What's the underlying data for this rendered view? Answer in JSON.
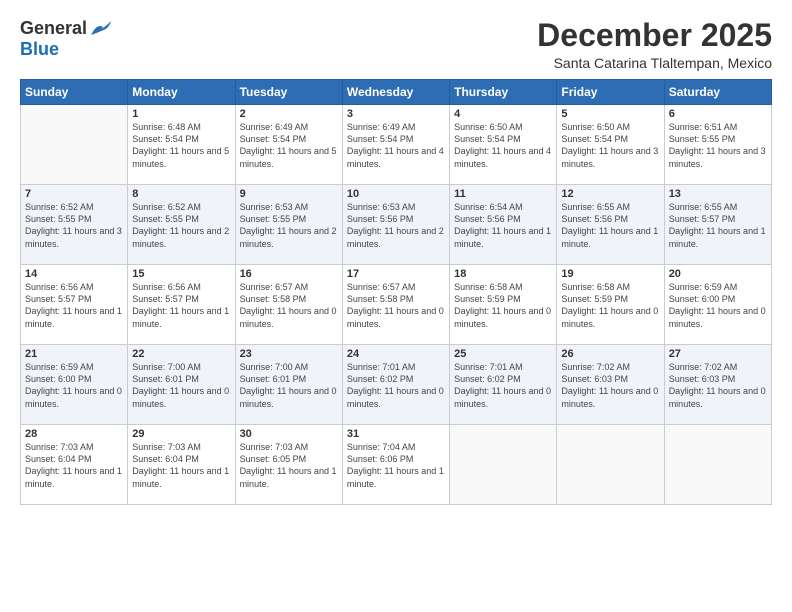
{
  "logo": {
    "general": "General",
    "blue": "Blue"
  },
  "title": "December 2025",
  "subtitle": "Santa Catarina Tlaltempan, Mexico",
  "headers": [
    "Sunday",
    "Monday",
    "Tuesday",
    "Wednesday",
    "Thursday",
    "Friday",
    "Saturday"
  ],
  "weeks": [
    [
      {
        "day": "",
        "sunrise": "",
        "sunset": "",
        "daylight": ""
      },
      {
        "day": "1",
        "sunrise": "Sunrise: 6:48 AM",
        "sunset": "Sunset: 5:54 PM",
        "daylight": "Daylight: 11 hours and 5 minutes."
      },
      {
        "day": "2",
        "sunrise": "Sunrise: 6:49 AM",
        "sunset": "Sunset: 5:54 PM",
        "daylight": "Daylight: 11 hours and 5 minutes."
      },
      {
        "day": "3",
        "sunrise": "Sunrise: 6:49 AM",
        "sunset": "Sunset: 5:54 PM",
        "daylight": "Daylight: 11 hours and 4 minutes."
      },
      {
        "day": "4",
        "sunrise": "Sunrise: 6:50 AM",
        "sunset": "Sunset: 5:54 PM",
        "daylight": "Daylight: 11 hours and 4 minutes."
      },
      {
        "day": "5",
        "sunrise": "Sunrise: 6:50 AM",
        "sunset": "Sunset: 5:54 PM",
        "daylight": "Daylight: 11 hours and 3 minutes."
      },
      {
        "day": "6",
        "sunrise": "Sunrise: 6:51 AM",
        "sunset": "Sunset: 5:55 PM",
        "daylight": "Daylight: 11 hours and 3 minutes."
      }
    ],
    [
      {
        "day": "7",
        "sunrise": "Sunrise: 6:52 AM",
        "sunset": "Sunset: 5:55 PM",
        "daylight": "Daylight: 11 hours and 3 minutes."
      },
      {
        "day": "8",
        "sunrise": "Sunrise: 6:52 AM",
        "sunset": "Sunset: 5:55 PM",
        "daylight": "Daylight: 11 hours and 2 minutes."
      },
      {
        "day": "9",
        "sunrise": "Sunrise: 6:53 AM",
        "sunset": "Sunset: 5:55 PM",
        "daylight": "Daylight: 11 hours and 2 minutes."
      },
      {
        "day": "10",
        "sunrise": "Sunrise: 6:53 AM",
        "sunset": "Sunset: 5:56 PM",
        "daylight": "Daylight: 11 hours and 2 minutes."
      },
      {
        "day": "11",
        "sunrise": "Sunrise: 6:54 AM",
        "sunset": "Sunset: 5:56 PM",
        "daylight": "Daylight: 11 hours and 1 minute."
      },
      {
        "day": "12",
        "sunrise": "Sunrise: 6:55 AM",
        "sunset": "Sunset: 5:56 PM",
        "daylight": "Daylight: 11 hours and 1 minute."
      },
      {
        "day": "13",
        "sunrise": "Sunrise: 6:55 AM",
        "sunset": "Sunset: 5:57 PM",
        "daylight": "Daylight: 11 hours and 1 minute."
      }
    ],
    [
      {
        "day": "14",
        "sunrise": "Sunrise: 6:56 AM",
        "sunset": "Sunset: 5:57 PM",
        "daylight": "Daylight: 11 hours and 1 minute."
      },
      {
        "day": "15",
        "sunrise": "Sunrise: 6:56 AM",
        "sunset": "Sunset: 5:57 PM",
        "daylight": "Daylight: 11 hours and 1 minute."
      },
      {
        "day": "16",
        "sunrise": "Sunrise: 6:57 AM",
        "sunset": "Sunset: 5:58 PM",
        "daylight": "Daylight: 11 hours and 0 minutes."
      },
      {
        "day": "17",
        "sunrise": "Sunrise: 6:57 AM",
        "sunset": "Sunset: 5:58 PM",
        "daylight": "Daylight: 11 hours and 0 minutes."
      },
      {
        "day": "18",
        "sunrise": "Sunrise: 6:58 AM",
        "sunset": "Sunset: 5:59 PM",
        "daylight": "Daylight: 11 hours and 0 minutes."
      },
      {
        "day": "19",
        "sunrise": "Sunrise: 6:58 AM",
        "sunset": "Sunset: 5:59 PM",
        "daylight": "Daylight: 11 hours and 0 minutes."
      },
      {
        "day": "20",
        "sunrise": "Sunrise: 6:59 AM",
        "sunset": "Sunset: 6:00 PM",
        "daylight": "Daylight: 11 hours and 0 minutes."
      }
    ],
    [
      {
        "day": "21",
        "sunrise": "Sunrise: 6:59 AM",
        "sunset": "Sunset: 6:00 PM",
        "daylight": "Daylight: 11 hours and 0 minutes."
      },
      {
        "day": "22",
        "sunrise": "Sunrise: 7:00 AM",
        "sunset": "Sunset: 6:01 PM",
        "daylight": "Daylight: 11 hours and 0 minutes."
      },
      {
        "day": "23",
        "sunrise": "Sunrise: 7:00 AM",
        "sunset": "Sunset: 6:01 PM",
        "daylight": "Daylight: 11 hours and 0 minutes."
      },
      {
        "day": "24",
        "sunrise": "Sunrise: 7:01 AM",
        "sunset": "Sunset: 6:02 PM",
        "daylight": "Daylight: 11 hours and 0 minutes."
      },
      {
        "day": "25",
        "sunrise": "Sunrise: 7:01 AM",
        "sunset": "Sunset: 6:02 PM",
        "daylight": "Daylight: 11 hours and 0 minutes."
      },
      {
        "day": "26",
        "sunrise": "Sunrise: 7:02 AM",
        "sunset": "Sunset: 6:03 PM",
        "daylight": "Daylight: 11 hours and 0 minutes."
      },
      {
        "day": "27",
        "sunrise": "Sunrise: 7:02 AM",
        "sunset": "Sunset: 6:03 PM",
        "daylight": "Daylight: 11 hours and 0 minutes."
      }
    ],
    [
      {
        "day": "28",
        "sunrise": "Sunrise: 7:03 AM",
        "sunset": "Sunset: 6:04 PM",
        "daylight": "Daylight: 11 hours and 1 minute."
      },
      {
        "day": "29",
        "sunrise": "Sunrise: 7:03 AM",
        "sunset": "Sunset: 6:04 PM",
        "daylight": "Daylight: 11 hours and 1 minute."
      },
      {
        "day": "30",
        "sunrise": "Sunrise: 7:03 AM",
        "sunset": "Sunset: 6:05 PM",
        "daylight": "Daylight: 11 hours and 1 minute."
      },
      {
        "day": "31",
        "sunrise": "Sunrise: 7:04 AM",
        "sunset": "Sunset: 6:06 PM",
        "daylight": "Daylight: 11 hours and 1 minute."
      },
      {
        "day": "",
        "sunrise": "",
        "sunset": "",
        "daylight": ""
      },
      {
        "day": "",
        "sunrise": "",
        "sunset": "",
        "daylight": ""
      },
      {
        "day": "",
        "sunrise": "",
        "sunset": "",
        "daylight": ""
      }
    ]
  ]
}
